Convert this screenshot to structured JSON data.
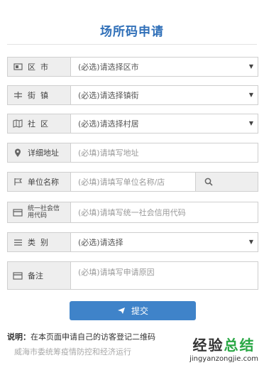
{
  "page": {
    "title": "场所码申请"
  },
  "form": {
    "district": {
      "label": "区  市",
      "value": "(必选)请选择区市"
    },
    "street": {
      "label": "街  镇",
      "value": "(必选)请选择镇街"
    },
    "community": {
      "label": "社  区",
      "value": "(必选)请选择村居"
    },
    "address": {
      "label": "详细地址",
      "placeholder": "(必填)请填写地址"
    },
    "unit_name": {
      "label": "单位名称",
      "placeholder": "(必填)请填写单位名称/店"
    },
    "credit_code": {
      "label": "统一社会信用代码",
      "placeholder": "(必填)请填写统一社会信用代码"
    },
    "category": {
      "label": "类  别",
      "value": "(必选)请选择"
    },
    "remark": {
      "label": "备注",
      "placeholder": "(必填)请填写申请原因"
    },
    "submit_label": "提交"
  },
  "footer": {
    "note_prefix": "说明：",
    "note_text": "在本页面申请自己的访客登记二维码",
    "note_line2": "威海市委统筹疫情防控和经济运行"
  },
  "watermark": {
    "line1_a": "经验",
    "line1_b": "总结",
    "line2": "jingyanzongjie.com"
  },
  "colors": {
    "accent": "#3f83c9",
    "title": "#2f6fb8",
    "watermark_green": "#2aa845"
  }
}
